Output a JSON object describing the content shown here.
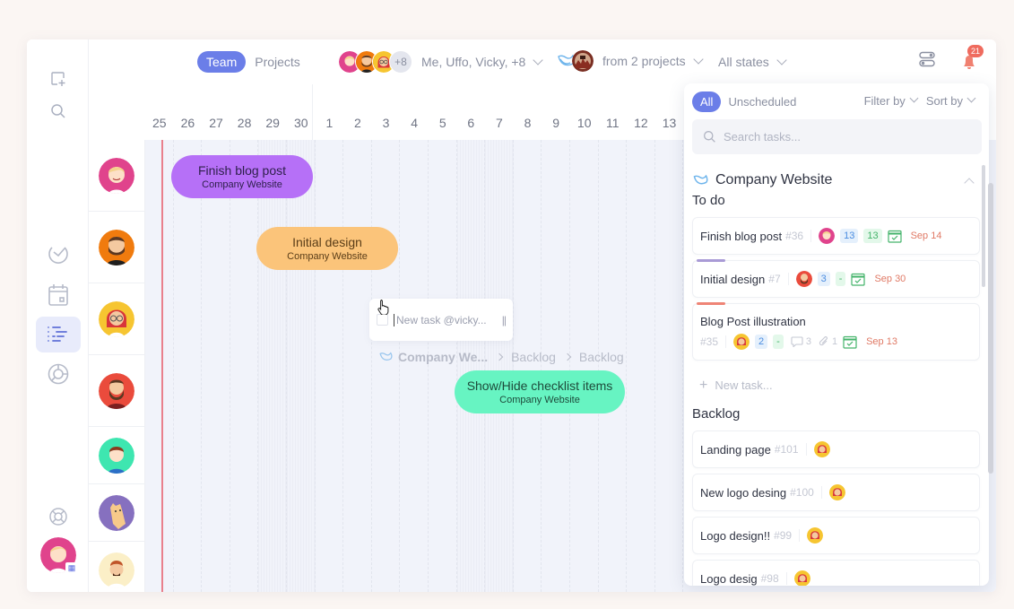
{
  "topbar": {
    "view_tabs": [
      {
        "label": "Team",
        "active": true
      },
      {
        "label": "Projects",
        "active": false
      }
    ],
    "people_filter": {
      "more_count": "+8",
      "label": "Me, Uffo, Vicky, +8"
    },
    "projects_filter": {
      "label": "from 2 projects"
    },
    "states_filter": {
      "label": "All states"
    },
    "notifications_count": "21"
  },
  "sidebar": {
    "items": [
      {
        "icon": "add-task-icon",
        "active": false
      },
      {
        "icon": "search-icon",
        "active": false
      },
      {
        "icon": "my-tasks-icon",
        "active": false
      },
      {
        "icon": "calendar-icon",
        "active": false
      },
      {
        "icon": "timeline-icon",
        "active": true
      },
      {
        "icon": "reports-icon",
        "active": false
      },
      {
        "icon": "help-icon",
        "active": false
      }
    ],
    "me_badge": "▦"
  },
  "timeline": {
    "days": [
      "25",
      "26",
      "27",
      "28",
      "29",
      "30",
      "1",
      "2",
      "3",
      "4",
      "5",
      "6",
      "7",
      "8",
      "9",
      "10",
      "11",
      "12",
      "13"
    ],
    "weekend_days": [
      "29",
      "30",
      "6",
      "7"
    ],
    "people_colors": [
      "#e0438c",
      "#f07b0e",
      "#f6c531",
      "#ea4b3c",
      "#3ee6b0",
      "#8670bf",
      "#fbefc7"
    ],
    "bars": [
      {
        "title": "Finish blog post",
        "project": "Company Website",
        "color": "purple"
      },
      {
        "title": "Initial design",
        "project": "Company Website",
        "color": "orange"
      },
      {
        "title": "Show/Hide checklist items",
        "project": "Company Website",
        "color": "green"
      }
    ],
    "new_task": {
      "placeholder": "New task @vicky...",
      "handle": "||"
    },
    "breadcrumb": [
      "Company We...",
      "Backlog",
      "Backlog"
    ]
  },
  "panel": {
    "tabs": [
      {
        "label": "All",
        "active": true
      },
      {
        "label": "Unscheduled",
        "active": false
      }
    ],
    "filter_label": "Filter by",
    "sort_label": "Sort by",
    "search_placeholder": "Search tasks...",
    "project": "Company Website",
    "groups": [
      {
        "title": "To do",
        "tasks": [
          {
            "name": "Finish blog post",
            "num": "#36",
            "chip1": "13",
            "chip2": "13",
            "date": "Sep 14"
          },
          {
            "name": "Initial design",
            "num": "#7",
            "chip1": "3",
            "chip2": "-",
            "date": "Sep 30",
            "accent": "#a99bd6"
          },
          {
            "name": "Blog Post illustration",
            "num": "#35",
            "chip1": "2",
            "chip2": "-",
            "comments": "3",
            "attachments": "1",
            "date": "Sep 13",
            "accent": "#ef8576"
          }
        ],
        "new_task_label": "New task..."
      },
      {
        "title": "Backlog",
        "tasks": [
          {
            "name": "Landing page",
            "num": "#101"
          },
          {
            "name": "New logo desing",
            "num": "#100"
          },
          {
            "name": "Logo design!!",
            "num": "#99"
          },
          {
            "name": "Logo desig",
            "num": "#98"
          }
        ]
      }
    ]
  }
}
